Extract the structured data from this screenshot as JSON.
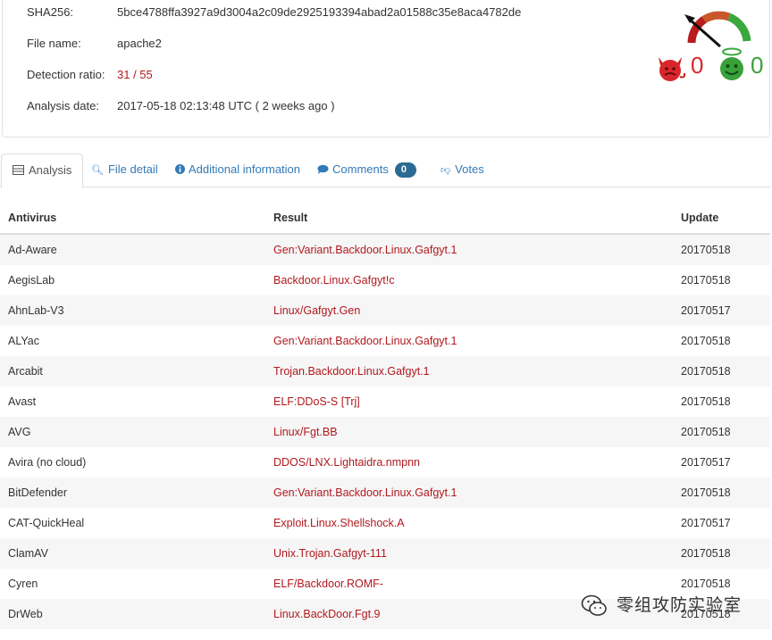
{
  "file_info": {
    "sha256_label": "SHA256:",
    "sha256_value": "5bce4788ffa3927a9d3004a2c09de2925193394abad2a01588c35e8aca4782de",
    "filename_label": "File name:",
    "filename_value": "apache2",
    "ratio_label": "Detection ratio:",
    "ratio_value": "31 / 55",
    "date_label": "Analysis date:",
    "date_value": "2017-05-18 02:13:48 UTC ( 2 weeks ago )"
  },
  "community_score": {
    "malicious_votes": "0",
    "harmless_votes": "0",
    "colors": {
      "bad": "#d9262b",
      "good": "#39a03a"
    }
  },
  "tabs": [
    {
      "label": "Analysis",
      "icon": "table-icon",
      "active": true
    },
    {
      "label": "File detail",
      "icon": "magnifier-icon"
    },
    {
      "label": "Additional information",
      "icon": "info-icon"
    },
    {
      "label": "Comments",
      "icon": "comment-icon",
      "badge": "0"
    },
    {
      "label": "Votes",
      "icon": "thumbs-down-icon"
    }
  ],
  "table": {
    "headers": [
      "Antivirus",
      "Result",
      "Update"
    ],
    "rows": [
      [
        "Ad-Aware",
        "Gen:Variant.Backdoor.Linux.Gafgyt.1",
        "20170518"
      ],
      [
        "AegisLab",
        "Backdoor.Linux.Gafgyt!c",
        "20170518"
      ],
      [
        "AhnLab-V3",
        "Linux/Gafgyt.Gen",
        "20170517"
      ],
      [
        "ALYac",
        "Gen:Variant.Backdoor.Linux.Gafgyt.1",
        "20170518"
      ],
      [
        "Arcabit",
        "Trojan.Backdoor.Linux.Gafgyt.1",
        "20170518"
      ],
      [
        "Avast",
        "ELF:DDoS-S [Trj]",
        "20170518"
      ],
      [
        "AVG",
        "Linux/Fgt.BB",
        "20170518"
      ],
      [
        "Avira (no cloud)",
        "DDOS/LNX.Lightaidra.nmpnn",
        "20170517"
      ],
      [
        "BitDefender",
        "Gen:Variant.Backdoor.Linux.Gafgyt.1",
        "20170518"
      ],
      [
        "CAT-QuickHeal",
        "Exploit.Linux.Shellshock.A",
        "20170517"
      ],
      [
        "ClamAV",
        "Unix.Trojan.Gafgyt-111",
        "20170518"
      ],
      [
        "Cyren",
        "ELF/Backdoor.ROMF-",
        "20170518"
      ],
      [
        "DrWeb",
        "Linux.BackDoor.Fgt.9",
        "20170518"
      ]
    ]
  },
  "watermark": {
    "text": "零组攻防实验室"
  },
  "colors": {
    "link": "#337ab7",
    "detection_red": "#b0191e",
    "badge": "#2b6b93"
  }
}
